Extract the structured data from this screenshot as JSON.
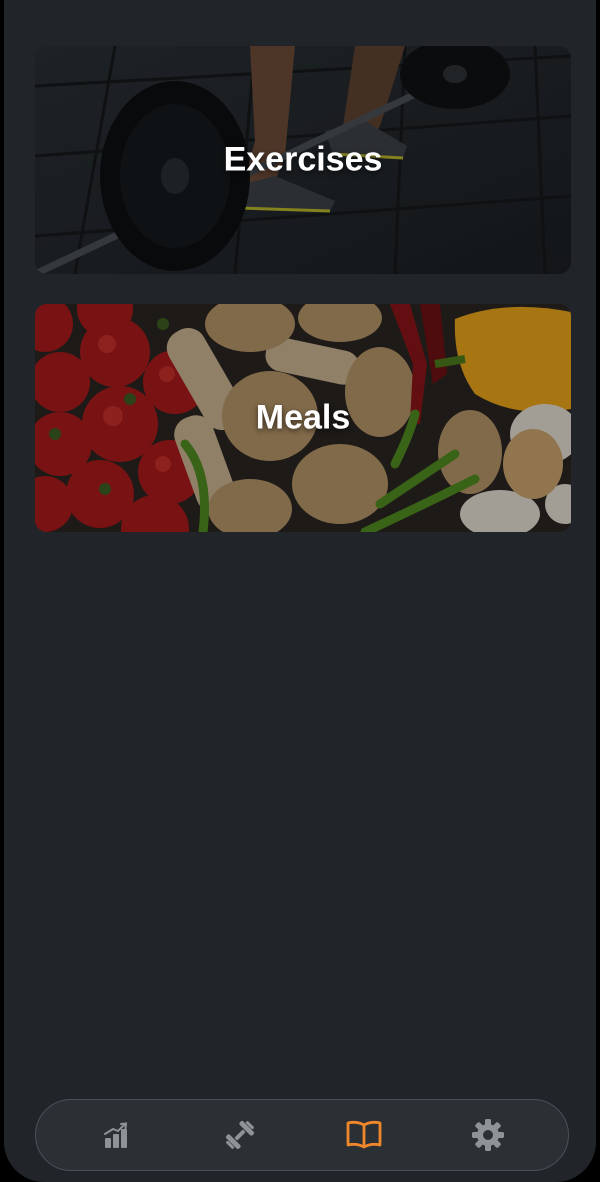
{
  "cards": [
    {
      "id": "exercises",
      "title": "Exercises"
    },
    {
      "id": "meals",
      "title": "Meals"
    }
  ],
  "tabbar": {
    "tabs": [
      {
        "icon": "stats-chart-icon",
        "active": false
      },
      {
        "icon": "dumbbell-icon",
        "active": false
      },
      {
        "icon": "book-icon",
        "active": true
      },
      {
        "icon": "gear-icon",
        "active": false
      }
    ]
  },
  "colors": {
    "background": "#212529",
    "tabbar_bg": "#2b3035",
    "icon_inactive": "#8e9398",
    "icon_active": "#f0872b",
    "title_text": "#ffffff"
  }
}
